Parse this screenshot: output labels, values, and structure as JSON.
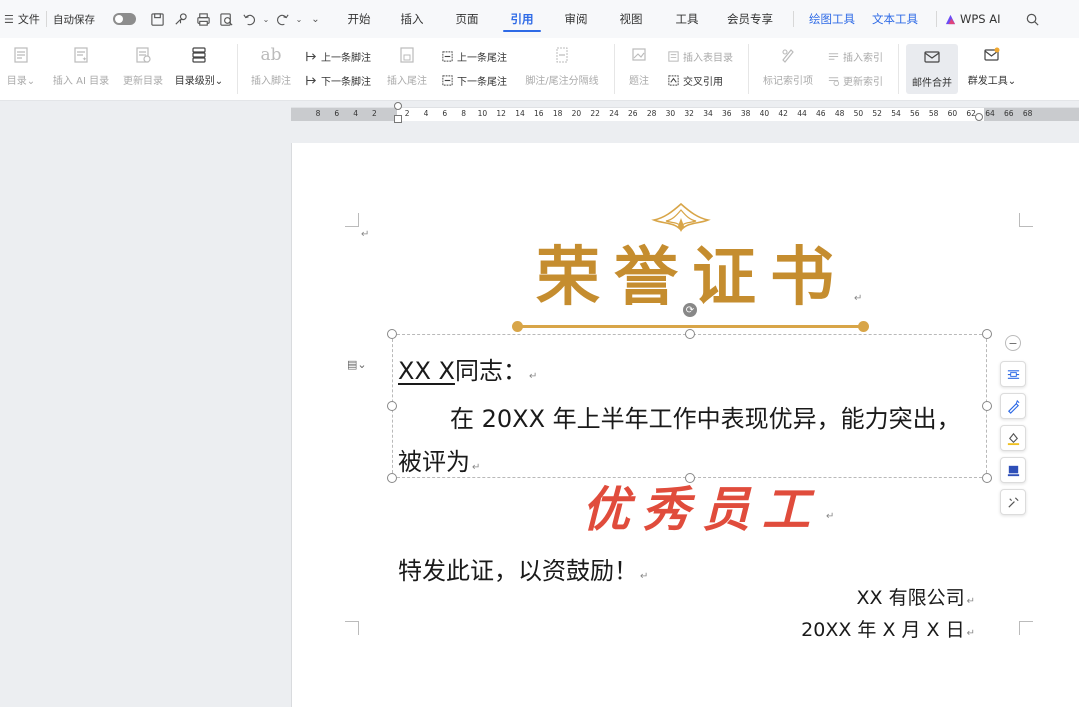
{
  "menubar": {
    "file_label": "文件",
    "autosave_label": "自动保存",
    "tabs": [
      {
        "label": "开始"
      },
      {
        "label": "插入"
      },
      {
        "label": "页面"
      },
      {
        "label": "引用"
      },
      {
        "label": "审阅"
      },
      {
        "label": "视图"
      },
      {
        "label": "工具"
      },
      {
        "label": "会员专享"
      }
    ],
    "context_tabs": [
      {
        "label": "绘图工具"
      },
      {
        "label": "文本工具"
      }
    ],
    "wps_ai_label": "WPS AI",
    "active_tab": "引用",
    "accent_color": "#2e6ae6"
  },
  "ribbon": {
    "toc": "目录",
    "insert_ai_toc": "插入 AI 目录",
    "update_toc": "更新目录",
    "toc_level": "目录级别",
    "insert_footnote": "插入脚注",
    "prev_footnote": "上一条脚注",
    "next_footnote": "下一条脚注",
    "insert_endnote": "插入尾注",
    "prev_endnote": "上一条尾注",
    "next_endnote": "下一条尾注",
    "separator_line": "脚注/尾注分隔线",
    "caption": "题注",
    "insert_table_of_figures": "插入表目录",
    "cross_reference": "交叉引用",
    "mark_index_entry": "标记索引项",
    "insert_index": "插入索引",
    "update_index": "更新索引",
    "mail_merge": "邮件合并",
    "bulk_tools": "群发工具"
  },
  "ruler": {
    "ticks": [
      "8",
      "6",
      "4",
      "2",
      "2",
      "4",
      "6",
      "8",
      "10",
      "12",
      "14",
      "16",
      "18",
      "20",
      "22",
      "24",
      "26",
      "28",
      "30",
      "32",
      "34",
      "36",
      "38",
      "40",
      "42",
      "44",
      "46",
      "48",
      "50",
      "52",
      "54",
      "56",
      "58",
      "60",
      "62",
      "64",
      "66",
      "68"
    ]
  },
  "document": {
    "title": "荣誉证书",
    "recipient_name": "XX X",
    "recipient_suffix": "同志：",
    "body_line1": "在 20XX 年上半年工作中表现优异，能力突出，",
    "body_line2": "被评为",
    "award": "优秀员工",
    "closing": "特发此证，以资鼓励！",
    "company": "XX 有限公司",
    "date": "20XX 年 X 月 X 日",
    "title_color": "#c58d2f",
    "award_color": "#e04c3c"
  }
}
